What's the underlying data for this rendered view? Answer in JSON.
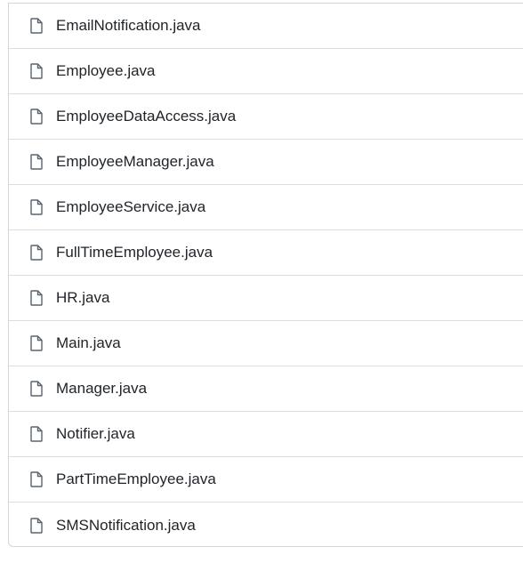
{
  "file_list": {
    "items": [
      {
        "label": "EmailNotification.java",
        "icon": "file-icon"
      },
      {
        "label": "Employee.java",
        "icon": "file-icon"
      },
      {
        "label": "EmployeeDataAccess.java",
        "icon": "file-icon"
      },
      {
        "label": "EmployeeManager.java",
        "icon": "file-icon"
      },
      {
        "label": "EmployeeService.java",
        "icon": "file-icon"
      },
      {
        "label": "FullTimeEmployee.java",
        "icon": "file-icon"
      },
      {
        "label": "HR.java",
        "icon": "file-icon"
      },
      {
        "label": "Main.java",
        "icon": "file-icon"
      },
      {
        "label": "Manager.java",
        "icon": "file-icon"
      },
      {
        "label": "Notifier.java",
        "icon": "file-icon"
      },
      {
        "label": "PartTimeEmployee.java",
        "icon": "file-icon"
      },
      {
        "label": "SMSNotification.java",
        "icon": "file-icon"
      }
    ]
  },
  "colors": {
    "border": "#d0d7de",
    "row_divider": "#d8dee4",
    "text": "#1f2328",
    "icon": "#59636e"
  }
}
